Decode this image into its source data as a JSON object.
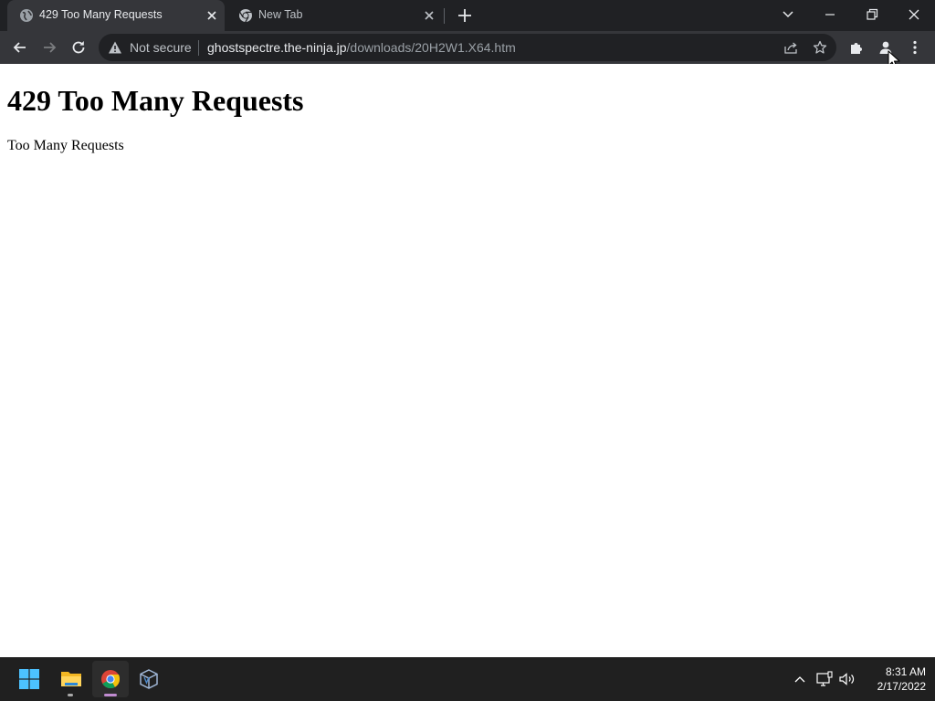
{
  "browser": {
    "tabs": [
      {
        "title": "429 Too Many Requests",
        "active": true,
        "favicon": "globe-icon"
      },
      {
        "title": "New Tab",
        "active": false,
        "favicon": "chrome-icon"
      }
    ],
    "omnibox": {
      "security_label": "Not secure",
      "url_host": "ghostspectre.the-ninja.jp",
      "url_path": "/downloads/20H2W1.X64.htm"
    },
    "colors": {
      "tabstrip": "#202124",
      "toolbar": "#35363a",
      "omnibox": "#202124"
    }
  },
  "page": {
    "heading": "429 Too Many Requests",
    "body": "Too Many Requests"
  },
  "taskbar": {
    "apps": [
      "start-icon",
      "file-explorer-icon",
      "chrome-icon",
      "virtualbox-icon"
    ],
    "tray_icons": [
      "chevron-up-icon",
      "network-icon",
      "volume-icon"
    ],
    "time": "8:31 AM",
    "date": "2/17/2022"
  }
}
